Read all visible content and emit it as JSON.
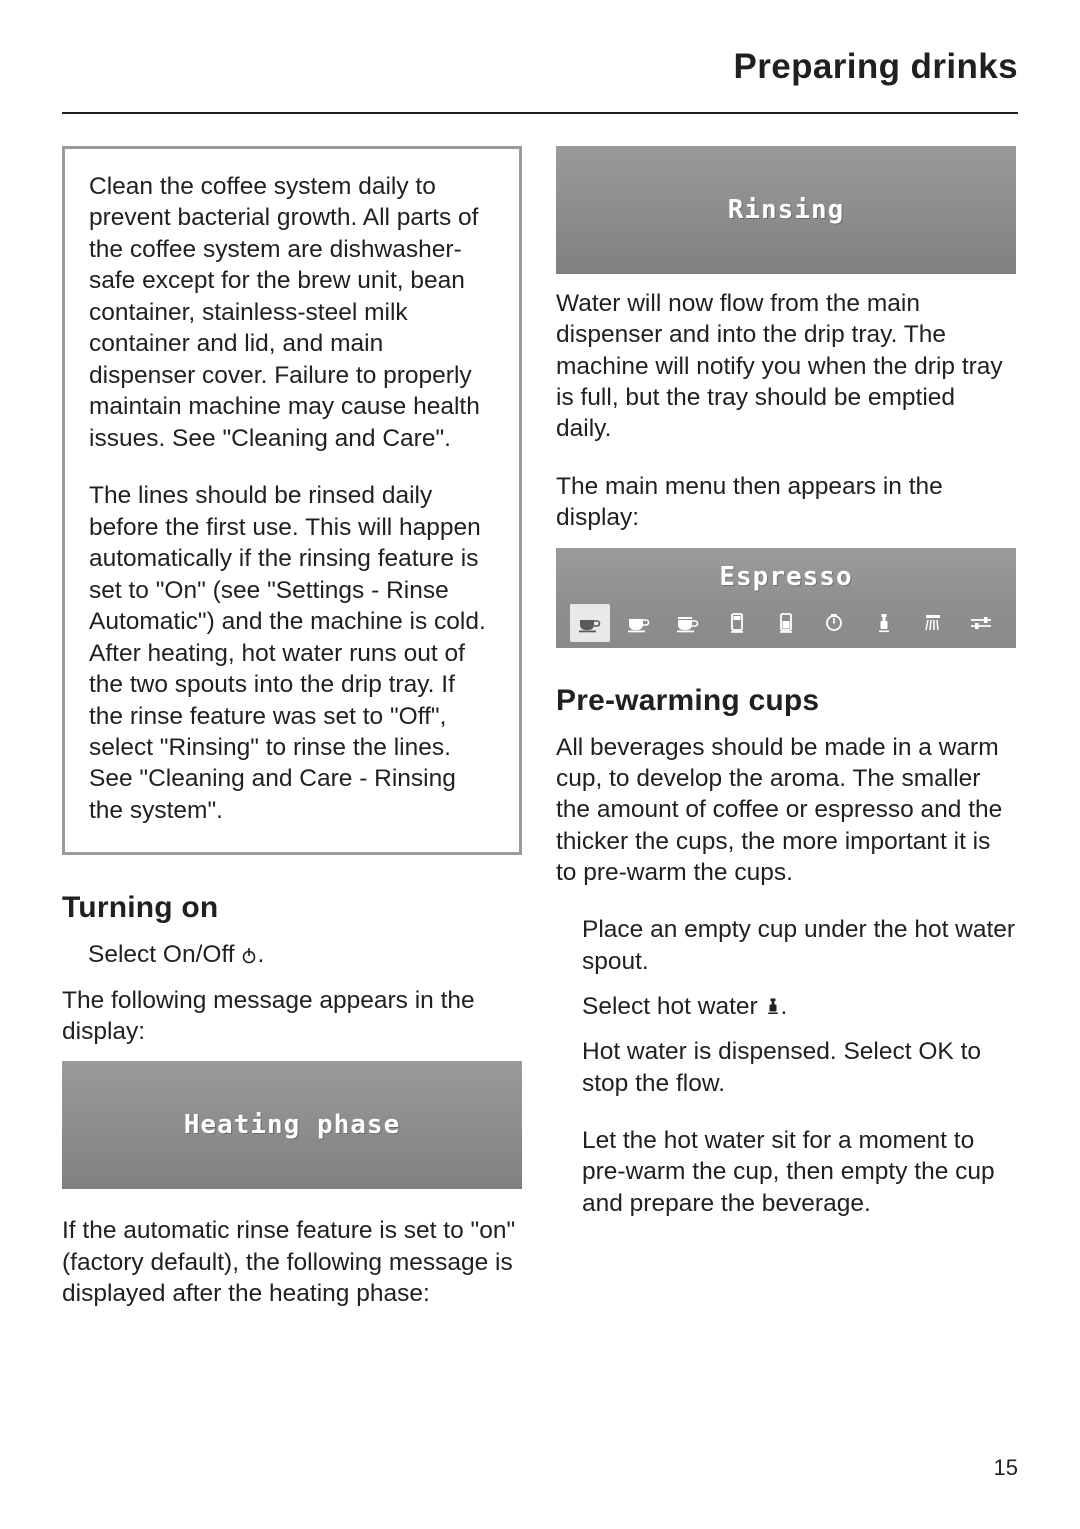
{
  "header": {
    "title": "Preparing drinks"
  },
  "left_column": {
    "note_box": {
      "paragraph_1": "Clean the coffee system daily to prevent bacterial growth. All parts of the coffee system are dishwasher-safe except for the brew unit, bean container, stainless-steel milk container and lid, and main dispenser cover. Failure to properly maintain machine may cause health issues. See \"Cleaning and Care\".",
      "paragraph_2": "The lines should be rinsed daily before the first use. This will happen automatically if the rinsing feature is set to \"On\" (see \"Settings - Rinse Automatic\") and the machine is cold. After heating, hot water runs out of the two spouts into the drip tray. If the rinse feature was set to \"Off\", select \"Rinsing\" to rinse the lines. See \"Cleaning and Care - Rinsing the system\"."
    },
    "heading": "Turning on",
    "step_1": "Select On/Off",
    "step_1_suffix": ".",
    "paragraph_1": "The following message appears in the display:",
    "display_1": "Heating phase",
    "paragraph_2": "If the automatic rinse feature is set to \"on\" (factory default), the following message is displayed after the heating phase:"
  },
  "right_column": {
    "display_rinsing": "Rinsing",
    "paragraph_1": "Water will now flow from the main dispenser and into the drip tray. The machine will notify you when the drip tray is full, but the tray should be emptied daily.",
    "paragraph_2": "The main menu then appears in the display:",
    "display_menu": {
      "label": "Espresso",
      "icons": [
        "espresso-cup-icon",
        "coffee-cup-icon",
        "cappuccino-cup-icon",
        "latte-macchiato-glass-icon",
        "milk-glass-icon",
        "hot-water-pot-icon",
        "hot-water-spout-icon",
        "steam-icon",
        "settings-sliders-icon"
      ],
      "selected_index": 0
    },
    "heading": "Pre-warming cups",
    "paragraph_3": "All beverages should be made in a warm cup, to develop the aroma. The smaller the amount of coffee or espresso and the thicker the cups, the more important it is to pre-warm the cups.",
    "step_1": "Place an empty cup under the hot water spout.",
    "step_2_prefix": "Select hot water",
    "step_2_suffix": ".",
    "step_3": "Hot water is dispensed. Select OK to stop the flow.",
    "step_4": "Let the hot water sit for a moment to pre-warm the cup, then empty the cup and prepare the beverage."
  },
  "footer": {
    "page_number": "15"
  }
}
